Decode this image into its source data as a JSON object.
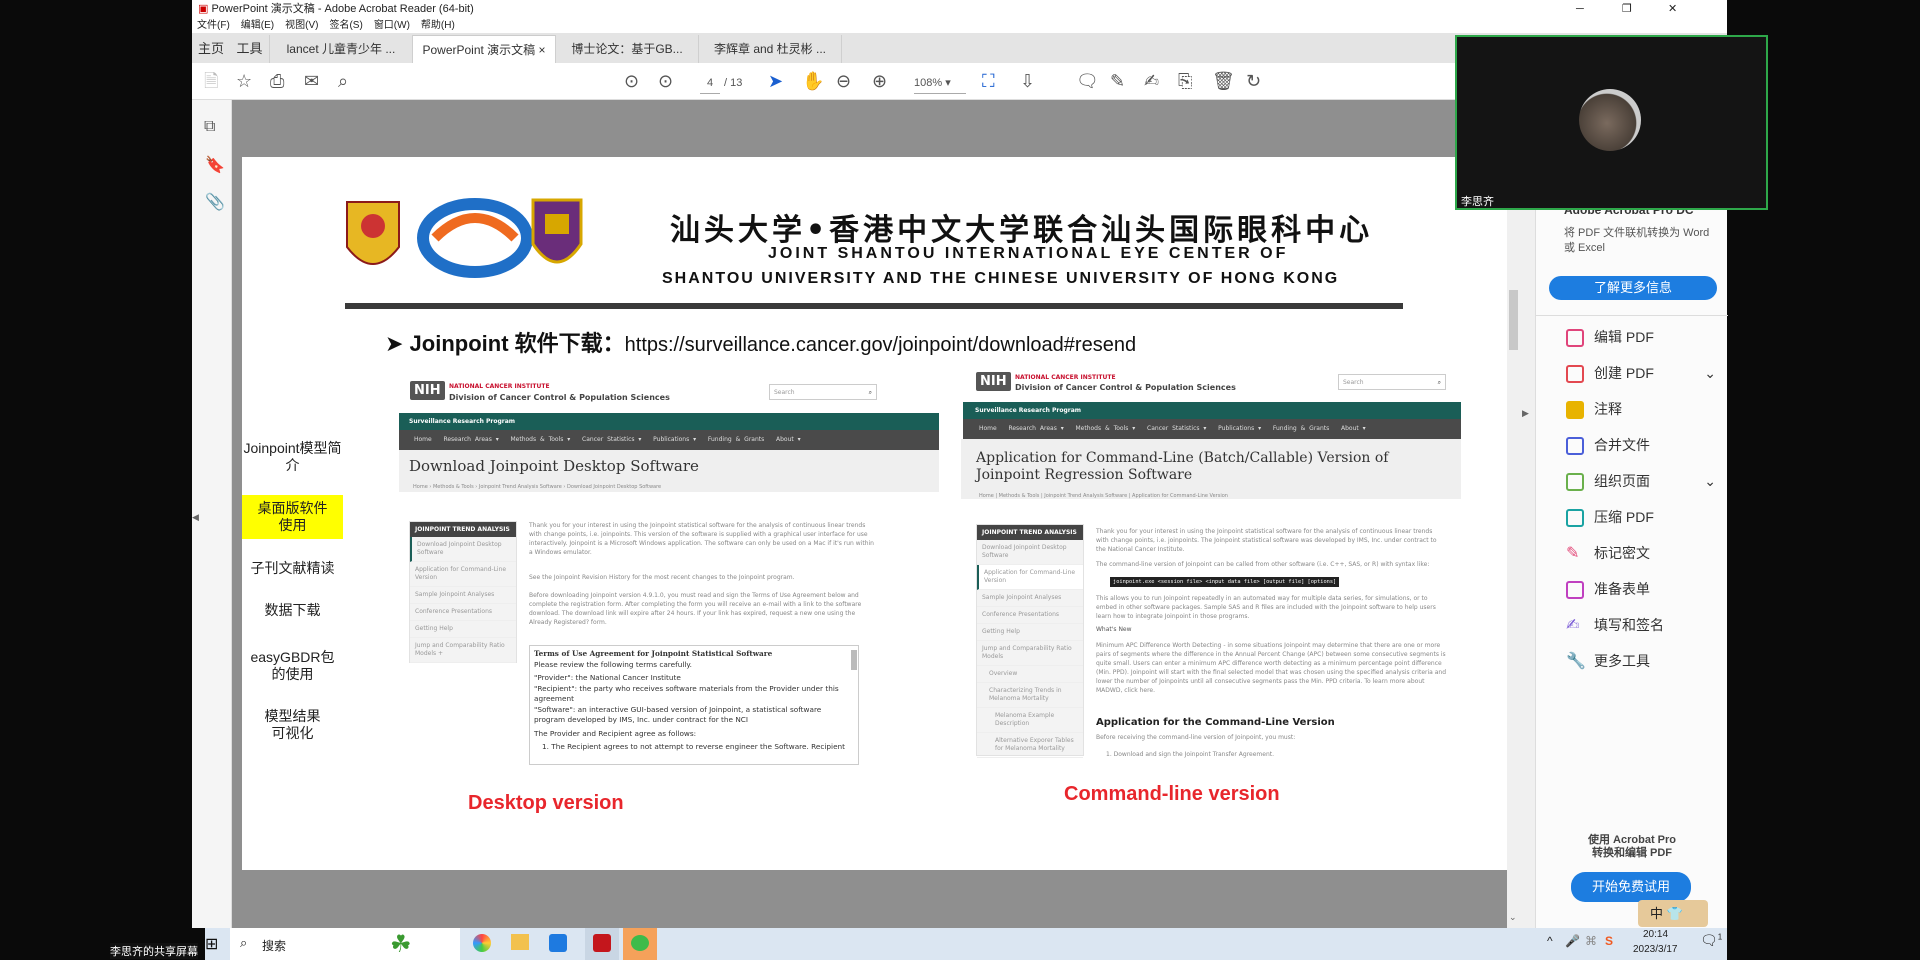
{
  "window": {
    "title": "PowerPoint 演示文稿 - Adobe Acrobat Reader (64-bit)",
    "menu": [
      "文件(F)",
      "编辑(E)",
      "视图(V)",
      "签名(S)",
      "窗口(W)",
      "帮助(H)"
    ],
    "tabs": [
      "主页",
      "工具",
      "lancet 儿童青少年 ...",
      "PowerPoint 演示文稿",
      "博士论文：基于GB...",
      "李辉章 and 杜灵彬 ..."
    ],
    "page_current": "4",
    "page_total": "/ 13",
    "zoom": "108%"
  },
  "slide": {
    "title_cn": "汕头大学•香港中文大学联合汕头国际眼科中心",
    "title_en1": "JOINT SHANTOU INTERNATIONAL EYE CENTER  OF",
    "title_en2": "SHANTOU UNIVERSITY AND THE CHINESE UNIVERSITY OF HONG KONG",
    "heading": "Joinpoint 软件下载：",
    "url": "https://surveillance.cancer.gov/joinpoint/download#resend",
    "menu": [
      "Joinpoint模型简介",
      "桌面版软件使用",
      "子刊文献精读",
      "数据下载",
      "easyGBDR包的使用",
      "模型结果可视化"
    ],
    "label_desktop": "Desktop version",
    "label_cmd": "Command-line version"
  },
  "site": {
    "nci": "NATIONAL CANCER INSTITUTE",
    "division": "Division of Cancer Control & Population Sciences",
    "nih": "NIH",
    "search": "Search",
    "program": "Surveillance Research Program",
    "nav": [
      "Home",
      "Research Areas ▾",
      "Methods & Tools ▾",
      "Cancer Statistics ▾",
      "Publications ▾",
      "Funding & Grants",
      "About ▾"
    ],
    "side_head": "JOINPOINT TREND ANALYSIS"
  },
  "desktop": {
    "title": "Download Joinpoint Desktop Software",
    "breadcrumb": "Home  ›  Methods & Tools  ›  Joinpoint Trend Analysis Software  ›  Download Joinpoint Desktop Software",
    "side": [
      "Download Joinpoint Desktop Software",
      "Application for Command-Line Version",
      "Sample Joinpoint Analyses",
      "Conference Presentations",
      "Getting Help",
      "Jump and Comparability Ratio Models  +"
    ],
    "p1": "Thank you for your interest in using the Joinpoint statistical software for the analysis of continuous linear trends with change points, i.e. joinpoints. This version of the software is supplied with a graphical user interface for use interactively. Joinpoint is a Microsoft Windows application. The software can only be used on a Mac if it's run within a Windows emulator.",
    "p2": "See the Joinpoint Revision History for the most recent changes to the Joinpoint program.",
    "p3": "Before downloading Joinpoint version 4.9.1.0, you must read and sign the Terms of Use Agreement below and complete the registration form. After completing the form you will receive an e-mail with a link to the software download. The download link will expire after 24 hours. If your link has expired, request a new one using the Already Registered? form.",
    "terms": [
      "Terms of Use Agreement for Joinpoint Statistical Software",
      "Please review the following terms carefully.",
      "\"Provider\": the National Cancer Institute",
      "\"Recipient\": the party who receives software materials from the Provider under this agreement",
      "\"Software\": an interactive GUI-based version of Joinpoint, a statistical software program developed by IMS, Inc. under contract for the NCI",
      "The Provider and Recipient agree as follows:",
      "1. The Recipient agrees to not attempt to reverse engineer the Software. Recipient"
    ]
  },
  "cmd": {
    "title": "Application for Command-Line (Batch/Callable) Version of Joinpoint Regression Software",
    "breadcrumb": "Home  |  Methods & Tools  |  Joinpoint Trend Analysis Software  |  Application for Command-Line Version",
    "side": [
      "Download Joinpoint Desktop Software",
      "Application for Command-Line Version",
      "Sample Joinpoint Analyses",
      "Conference Presentations",
      "Getting Help",
      "Jump and Comparability Ratio Models",
      "Overview",
      "Characterizing Trends in Melanoma Mortality",
      "Melanoma Example Description",
      "Alternative Exporer Tables for Melanoma Mortality"
    ],
    "p1": "Thank you for your interest in using the Joinpoint statistical software for the analysis of continuous linear trends with change points, i.e. joinpoints. The Joinpoint statistical software was developed by IMS, Inc. under contract to the National Cancer Institute.",
    "p2": "The command-line version of Joinpoint can be called from other software (i.e. C++, SAS, or R) with syntax like:",
    "code": "joinpoint.exe <session file> <input data file> [output file] [options]",
    "p3": "This allows you to run Joinpoint repeatedly in an automated way for multiple data series, for simulations, or to embed in other software packages. Sample SAS and R files are included with the Joinpoint software to help users learn how to integrate Joinpoint in those programs.",
    "whats_new": "What's New",
    "p4": "Minimum APC Difference Worth Detecting - in some situations Joinpoint may determine that there are one or more pairs of segments where the difference in the Annual Percent Change (APC) between some consecutive segments is quite small. Users can enter a minimum APC difference worth detecting as a minimum percentage point difference (Min. PPD). Joinpoint will start with the final selected model that was chosen using the specified analysis criteria and lower the number of Joinpoints until all consecutive segments pass the Min. PPD criteria. To learn more about MADWD, click here.",
    "h2": "Application for the Command-Line Version",
    "p5": "Before receiving the command-line version of Joinpoint, you must:",
    "li1": "1. Download and sign the Joinpoint Transfer Agreement."
  },
  "right_panel": {
    "promo_title": "Adobe Acrobat Pro DC",
    "promo_desc": "将 PDF 文件联机转换为 Word 或 Excel",
    "learn_more": "了解更多信息",
    "tools": [
      {
        "label": "编辑 PDF",
        "color": "#e0457b"
      },
      {
        "label": "创建 PDF",
        "color": "#e34850"
      },
      {
        "label": "注释",
        "color": "#e8b300"
      },
      {
        "label": "合并文件",
        "color": "#4b5fd9"
      },
      {
        "label": "组织页面",
        "color": "#6ab04c"
      },
      {
        "label": "压缩 PDF",
        "color": "#1aa3a3"
      },
      {
        "label": "标记密文",
        "color": "#e34878"
      },
      {
        "label": "准备表单",
        "color": "#c040c0"
      },
      {
        "label": "填写和签名",
        "color": "#7b5cd6"
      },
      {
        "label": "更多工具",
        "color": "#555555"
      }
    ],
    "bottom_line1": "使用 Acrobat Pro",
    "bottom_line2": "转换和编辑 PDF",
    "trial": "开始免费试用"
  },
  "video": {
    "name": "李思齐"
  },
  "share_label": "李思齐的共享屏幕",
  "taskbar": {
    "search": "搜索",
    "time": "20:14",
    "date": "2023/3/17",
    "ime": "中",
    "notifications": "1"
  }
}
